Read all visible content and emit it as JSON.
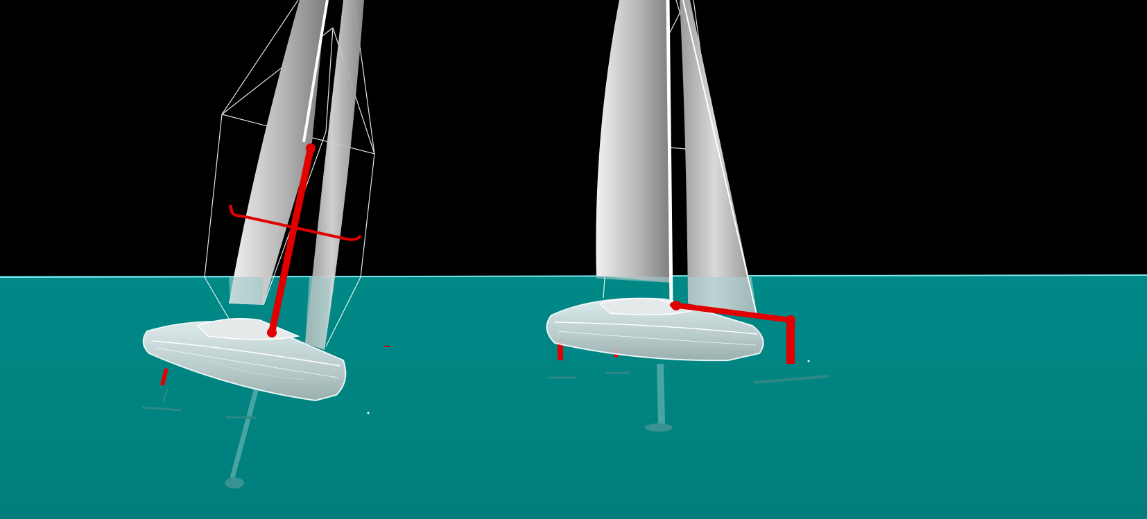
{
  "scene": {
    "colors": {
      "sky": "#000000",
      "water": "#008583",
      "horizon_line": "#7fe6ee",
      "sail_light": "#e9e9e9",
      "sail_dark": "#8a8a8a",
      "hull": "#cfd6d6",
      "rig_line": "#ffffff",
      "red_appendage": "#e00000",
      "underwater_foil": "#5fb0ae"
    },
    "boats": [
      {
        "id": "left-boat",
        "description_icon": "sailboat-icon"
      },
      {
        "id": "right-boat",
        "description_icon": "sailboat-icon"
      }
    ]
  }
}
